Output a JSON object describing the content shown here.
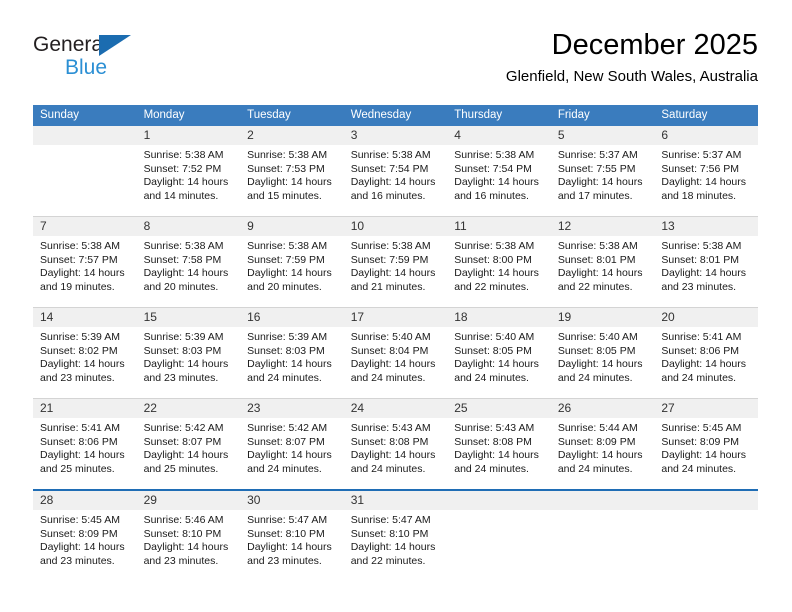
{
  "brand": {
    "name_top": "General",
    "name_bottom": "Blue",
    "triangle_color": "#1b6cb0",
    "blue_text_color": "#2b8fd4"
  },
  "header": {
    "title": "December 2025",
    "subtitle": "Glenfield, New South Wales, Australia"
  },
  "theme": {
    "header_band_color": "#3a7cbe",
    "daynum_band_color": "#f0f0f0",
    "row_divider_color": "#d4d4d4",
    "last_row_border_color": "#1f6db5"
  },
  "weekday_headers": [
    "Sunday",
    "Monday",
    "Tuesday",
    "Wednesday",
    "Thursday",
    "Friday",
    "Saturday"
  ],
  "weeks": [
    [
      {
        "day": "",
        "empty": true,
        "sunrise": "",
        "sunset": "",
        "daylight_line1": "",
        "daylight_line2": ""
      },
      {
        "day": "1",
        "sunrise": "Sunrise: 5:38 AM",
        "sunset": "Sunset: 7:52 PM",
        "daylight_line1": "Daylight: 14 hours",
        "daylight_line2": "and 14 minutes."
      },
      {
        "day": "2",
        "sunrise": "Sunrise: 5:38 AM",
        "sunset": "Sunset: 7:53 PM",
        "daylight_line1": "Daylight: 14 hours",
        "daylight_line2": "and 15 minutes."
      },
      {
        "day": "3",
        "sunrise": "Sunrise: 5:38 AM",
        "sunset": "Sunset: 7:54 PM",
        "daylight_line1": "Daylight: 14 hours",
        "daylight_line2": "and 16 minutes."
      },
      {
        "day": "4",
        "sunrise": "Sunrise: 5:38 AM",
        "sunset": "Sunset: 7:54 PM",
        "daylight_line1": "Daylight: 14 hours",
        "daylight_line2": "and 16 minutes."
      },
      {
        "day": "5",
        "sunrise": "Sunrise: 5:37 AM",
        "sunset": "Sunset: 7:55 PM",
        "daylight_line1": "Daylight: 14 hours",
        "daylight_line2": "and 17 minutes."
      },
      {
        "day": "6",
        "sunrise": "Sunrise: 5:37 AM",
        "sunset": "Sunset: 7:56 PM",
        "daylight_line1": "Daylight: 14 hours",
        "daylight_line2": "and 18 minutes."
      }
    ],
    [
      {
        "day": "7",
        "sunrise": "Sunrise: 5:38 AM",
        "sunset": "Sunset: 7:57 PM",
        "daylight_line1": "Daylight: 14 hours",
        "daylight_line2": "and 19 minutes."
      },
      {
        "day": "8",
        "sunrise": "Sunrise: 5:38 AM",
        "sunset": "Sunset: 7:58 PM",
        "daylight_line1": "Daylight: 14 hours",
        "daylight_line2": "and 20 minutes."
      },
      {
        "day": "9",
        "sunrise": "Sunrise: 5:38 AM",
        "sunset": "Sunset: 7:59 PM",
        "daylight_line1": "Daylight: 14 hours",
        "daylight_line2": "and 20 minutes."
      },
      {
        "day": "10",
        "sunrise": "Sunrise: 5:38 AM",
        "sunset": "Sunset: 7:59 PM",
        "daylight_line1": "Daylight: 14 hours",
        "daylight_line2": "and 21 minutes."
      },
      {
        "day": "11",
        "sunrise": "Sunrise: 5:38 AM",
        "sunset": "Sunset: 8:00 PM",
        "daylight_line1": "Daylight: 14 hours",
        "daylight_line2": "and 22 minutes."
      },
      {
        "day": "12",
        "sunrise": "Sunrise: 5:38 AM",
        "sunset": "Sunset: 8:01 PM",
        "daylight_line1": "Daylight: 14 hours",
        "daylight_line2": "and 22 minutes."
      },
      {
        "day": "13",
        "sunrise": "Sunrise: 5:38 AM",
        "sunset": "Sunset: 8:01 PM",
        "daylight_line1": "Daylight: 14 hours",
        "daylight_line2": "and 23 minutes."
      }
    ],
    [
      {
        "day": "14",
        "sunrise": "Sunrise: 5:39 AM",
        "sunset": "Sunset: 8:02 PM",
        "daylight_line1": "Daylight: 14 hours",
        "daylight_line2": "and 23 minutes."
      },
      {
        "day": "15",
        "sunrise": "Sunrise: 5:39 AM",
        "sunset": "Sunset: 8:03 PM",
        "daylight_line1": "Daylight: 14 hours",
        "daylight_line2": "and 23 minutes."
      },
      {
        "day": "16",
        "sunrise": "Sunrise: 5:39 AM",
        "sunset": "Sunset: 8:03 PM",
        "daylight_line1": "Daylight: 14 hours",
        "daylight_line2": "and 24 minutes."
      },
      {
        "day": "17",
        "sunrise": "Sunrise: 5:40 AM",
        "sunset": "Sunset: 8:04 PM",
        "daylight_line1": "Daylight: 14 hours",
        "daylight_line2": "and 24 minutes."
      },
      {
        "day": "18",
        "sunrise": "Sunrise: 5:40 AM",
        "sunset": "Sunset: 8:05 PM",
        "daylight_line1": "Daylight: 14 hours",
        "daylight_line2": "and 24 minutes."
      },
      {
        "day": "19",
        "sunrise": "Sunrise: 5:40 AM",
        "sunset": "Sunset: 8:05 PM",
        "daylight_line1": "Daylight: 14 hours",
        "daylight_line2": "and 24 minutes."
      },
      {
        "day": "20",
        "sunrise": "Sunrise: 5:41 AM",
        "sunset": "Sunset: 8:06 PM",
        "daylight_line1": "Daylight: 14 hours",
        "daylight_line2": "and 24 minutes."
      }
    ],
    [
      {
        "day": "21",
        "sunrise": "Sunrise: 5:41 AM",
        "sunset": "Sunset: 8:06 PM",
        "daylight_line1": "Daylight: 14 hours",
        "daylight_line2": "and 25 minutes."
      },
      {
        "day": "22",
        "sunrise": "Sunrise: 5:42 AM",
        "sunset": "Sunset: 8:07 PM",
        "daylight_line1": "Daylight: 14 hours",
        "daylight_line2": "and 25 minutes."
      },
      {
        "day": "23",
        "sunrise": "Sunrise: 5:42 AM",
        "sunset": "Sunset: 8:07 PM",
        "daylight_line1": "Daylight: 14 hours",
        "daylight_line2": "and 24 minutes."
      },
      {
        "day": "24",
        "sunrise": "Sunrise: 5:43 AM",
        "sunset": "Sunset: 8:08 PM",
        "daylight_line1": "Daylight: 14 hours",
        "daylight_line2": "and 24 minutes."
      },
      {
        "day": "25",
        "sunrise": "Sunrise: 5:43 AM",
        "sunset": "Sunset: 8:08 PM",
        "daylight_line1": "Daylight: 14 hours",
        "daylight_line2": "and 24 minutes."
      },
      {
        "day": "26",
        "sunrise": "Sunrise: 5:44 AM",
        "sunset": "Sunset: 8:09 PM",
        "daylight_line1": "Daylight: 14 hours",
        "daylight_line2": "and 24 minutes."
      },
      {
        "day": "27",
        "sunrise": "Sunrise: 5:45 AM",
        "sunset": "Sunset: 8:09 PM",
        "daylight_line1": "Daylight: 14 hours",
        "daylight_line2": "and 24 minutes."
      }
    ],
    [
      {
        "day": "28",
        "sunrise": "Sunrise: 5:45 AM",
        "sunset": "Sunset: 8:09 PM",
        "daylight_line1": "Daylight: 14 hours",
        "daylight_line2": "and 23 minutes."
      },
      {
        "day": "29",
        "sunrise": "Sunrise: 5:46 AM",
        "sunset": "Sunset: 8:10 PM",
        "daylight_line1": "Daylight: 14 hours",
        "daylight_line2": "and 23 minutes."
      },
      {
        "day": "30",
        "sunrise": "Sunrise: 5:47 AM",
        "sunset": "Sunset: 8:10 PM",
        "daylight_line1": "Daylight: 14 hours",
        "daylight_line2": "and 23 minutes."
      },
      {
        "day": "31",
        "sunrise": "Sunrise: 5:47 AM",
        "sunset": "Sunset: 8:10 PM",
        "daylight_line1": "Daylight: 14 hours",
        "daylight_line2": "and 22 minutes."
      },
      {
        "day": "",
        "empty": true,
        "sunrise": "",
        "sunset": "",
        "daylight_line1": "",
        "daylight_line2": ""
      },
      {
        "day": "",
        "empty": true,
        "sunrise": "",
        "sunset": "",
        "daylight_line1": "",
        "daylight_line2": ""
      },
      {
        "day": "",
        "empty": true,
        "sunrise": "",
        "sunset": "",
        "daylight_line1": "",
        "daylight_line2": ""
      }
    ]
  ]
}
